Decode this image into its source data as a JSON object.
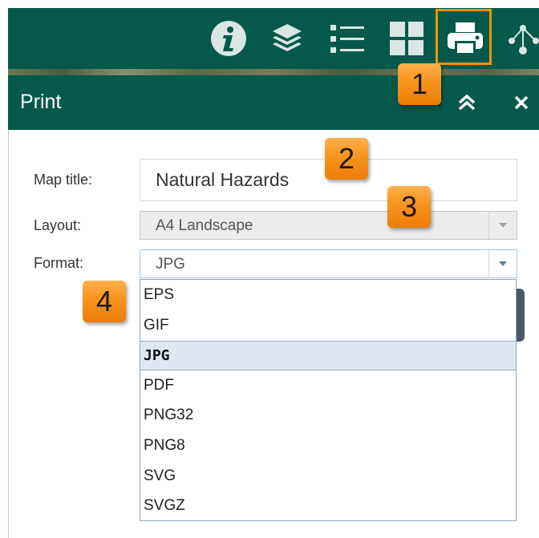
{
  "toolbar": {
    "tools": [
      {
        "icon": "info-icon"
      },
      {
        "icon": "layers-icon"
      },
      {
        "icon": "legend-list-icon"
      },
      {
        "icon": "basemap-gallery-icon"
      },
      {
        "icon": "print-icon",
        "active": true
      },
      {
        "icon": "share-network-icon"
      }
    ],
    "highlight_color": "#f39200",
    "background_color": "#05594a"
  },
  "print_panel": {
    "title": "Print",
    "collapse_icon": "double-chevron-up-icon",
    "close_icon": "close-icon"
  },
  "form": {
    "map_title_label": "Map title:",
    "map_title_value": "Natural Hazards",
    "layout_label": "Layout:",
    "layout_value": "A4 Landscape",
    "format_label": "Format:",
    "format_value": "JPG",
    "format_options": [
      "EPS",
      "GIF",
      "JPG",
      "PDF",
      "PNG32",
      "PNG8",
      "SVG",
      "SVGZ"
    ],
    "format_selected": "JPG"
  },
  "callouts": [
    "1",
    "2",
    "3",
    "4"
  ]
}
